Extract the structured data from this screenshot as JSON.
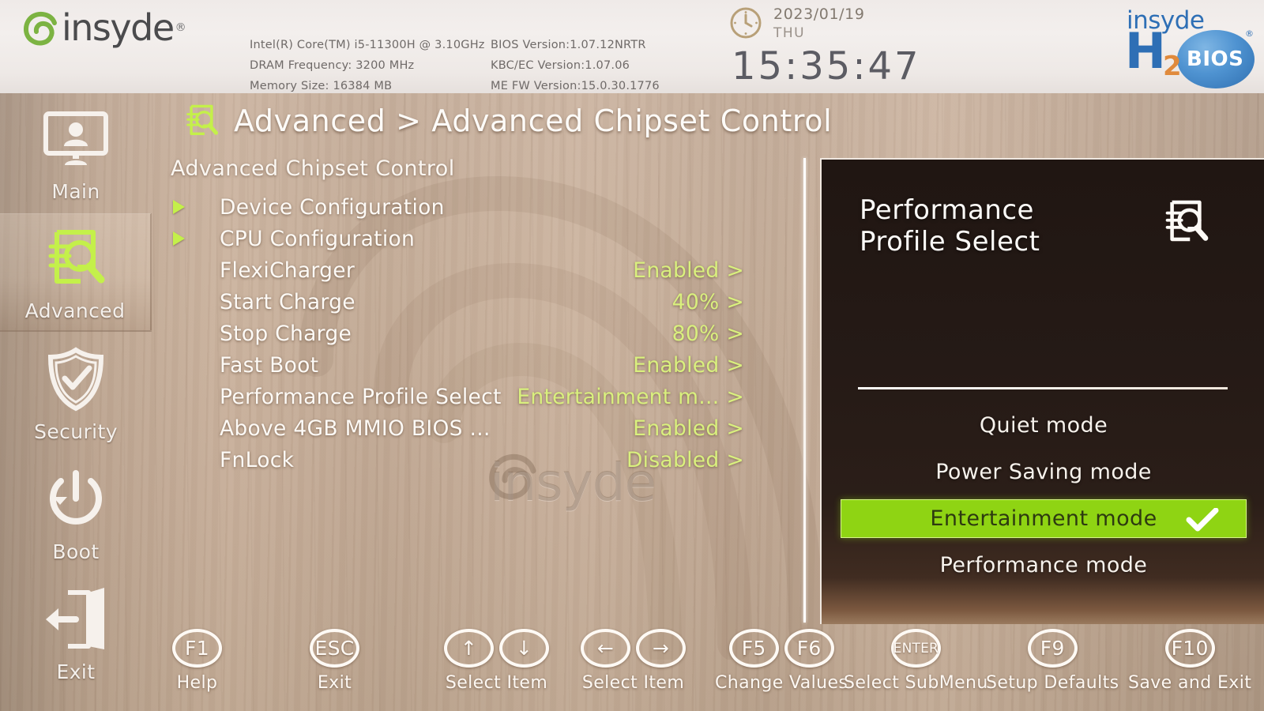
{
  "header": {
    "brand": "insyde",
    "brand_reg": "®",
    "sysinfo": [
      {
        "left": "Intel(R) Core(TM) i5-11300H @ 3.10GHz",
        "right": "BIOS Version:1.07.12NRTR"
      },
      {
        "left": "DRAM Frequency: 3200 MHz",
        "right": "KBC/EC Version:1.07.06"
      },
      {
        "left": "Memory Size: 16384 MB",
        "right": "ME FW Version:15.0.30.1776"
      }
    ],
    "clock": {
      "date": "2023/01/19",
      "weekday": "THU",
      "time": "15:35:47",
      "icon": "clock-icon"
    },
    "h2o_logo": {
      "line1": "insyde",
      "big": "H",
      "sub": "2",
      "bios": "BIOS",
      "reg": "®"
    }
  },
  "sidebar": {
    "items": [
      {
        "label": "Main",
        "icon": "monitor-user-icon",
        "active": false
      },
      {
        "label": "Advanced",
        "icon": "document-search-icon",
        "active": true
      },
      {
        "label": "Security",
        "icon": "shield-check-icon",
        "active": false
      },
      {
        "label": "Boot",
        "icon": "power-refresh-icon",
        "active": false
      },
      {
        "label": "Exit",
        "icon": "door-exit-icon",
        "active": false
      }
    ]
  },
  "main": {
    "breadcrumb": "Advanced > Advanced Chipset Control",
    "breadcrumb_icon": "document-search-icon",
    "section_title": "Advanced Chipset Control",
    "watermark": "insyde",
    "rows": [
      {
        "label": "Device Configuration",
        "value": "",
        "submenu": true
      },
      {
        "label": "CPU Configuration",
        "value": "",
        "submenu": true
      },
      {
        "label": "FlexiCharger",
        "value": "Enabled",
        "submenu": false
      },
      {
        "label": "Start Charge",
        "value": "40%",
        "submenu": false
      },
      {
        "label": "Stop Charge",
        "value": "80%",
        "submenu": false
      },
      {
        "label": "Fast Boot",
        "value": "Enabled",
        "submenu": false
      },
      {
        "label": "Performance Profile Select",
        "value": "Entertainment m...",
        "submenu": false
      },
      {
        "label": "Above 4GB MMIO BIOS ...",
        "value": "Enabled",
        "submenu": false
      },
      {
        "label": "FnLock",
        "value": "Disabled",
        "submenu": false
      }
    ],
    "value_chevron": ">"
  },
  "dialog": {
    "title_line1": "Performance",
    "title_line2": "Profile Select",
    "icon": "document-search-icon",
    "options": [
      {
        "label": "Quiet mode",
        "selected": false
      },
      {
        "label": "Power Saving mode",
        "selected": false
      },
      {
        "label": "Entertainment mode",
        "selected": true
      },
      {
        "label": "Performance mode",
        "selected": false
      }
    ],
    "check_icon": "check-icon"
  },
  "keybar": [
    {
      "keys": [
        "F1"
      ],
      "label": "Help",
      "style": "normal"
    },
    {
      "keys": [
        "ESC"
      ],
      "label": "Exit",
      "style": "normal"
    },
    {
      "keys": [
        "↑",
        "↓"
      ],
      "label": "Select Item",
      "style": "arrow"
    },
    {
      "keys": [
        "←",
        "→"
      ],
      "label": "Select Item",
      "style": "arrow"
    },
    {
      "keys": [
        "F5",
        "F6"
      ],
      "label": "Change Values",
      "style": "normal"
    },
    {
      "keys": [
        "ENTER"
      ],
      "label": "Select  SubMenu",
      "style": "small"
    },
    {
      "keys": [
        "F9"
      ],
      "label": "Setup Defaults",
      "style": "normal"
    },
    {
      "keys": [
        "F10"
      ],
      "label": "Save and Exit",
      "style": "normal"
    }
  ],
  "colors": {
    "accent_green": "#c4f04a",
    "value_green": "#d9f07e",
    "highlight_green": "#8fd413",
    "panel_dark": "#241915",
    "wood": "#c9b19c",
    "brand_blue": "#2e6fb5",
    "brand_orange": "#e08a3c"
  }
}
